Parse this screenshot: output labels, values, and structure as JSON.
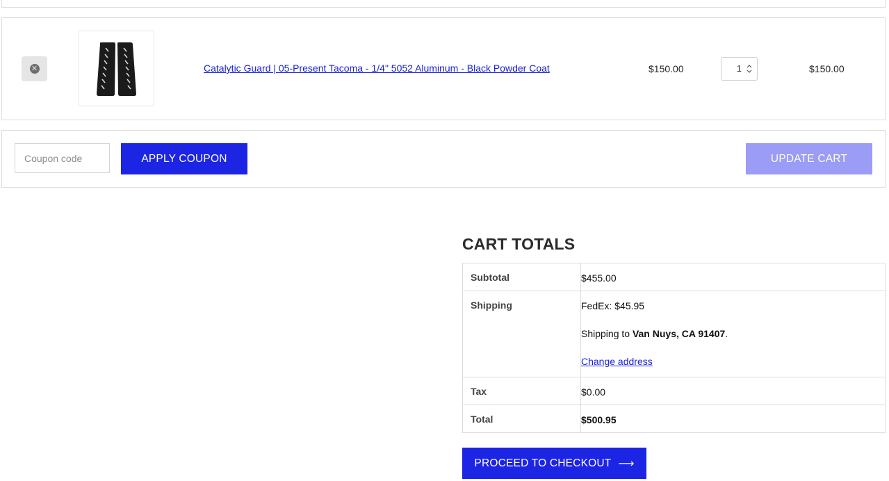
{
  "cart_item": {
    "remove_icon": "close-circle-icon",
    "product_name": "Catalytic Guard | 05-Present Tacoma - 1/4\" 5052 Aluminum - Black Powder Coat",
    "price": "$150.00",
    "quantity": "1",
    "line_total": "$150.00"
  },
  "actions": {
    "coupon_placeholder": "Coupon code",
    "apply_label": "APPLY COUPON",
    "update_label": "UPDATE CART"
  },
  "totals": {
    "title": "CART TOTALS",
    "subtotal_label": "Subtotal",
    "subtotal_value": "$455.00",
    "shipping_label": "Shipping",
    "shipping_method": "FedEx: $45.95",
    "shipping_to_prefix": "Shipping to ",
    "shipping_destination": "Van Nuys, CA 91407",
    "shipping_to_suffix": ".",
    "change_address": "Change address",
    "tax_label": "Tax",
    "tax_value": "$0.00",
    "total_label": "Total",
    "total_value": "$500.95",
    "checkout_label": "PROCEED TO CHECKOUT",
    "checkout_icon": "arrow-right-icon"
  },
  "colors": {
    "primary": "#1c25e4",
    "disabled": "#9a9cf5",
    "link": "#1a22d6"
  }
}
